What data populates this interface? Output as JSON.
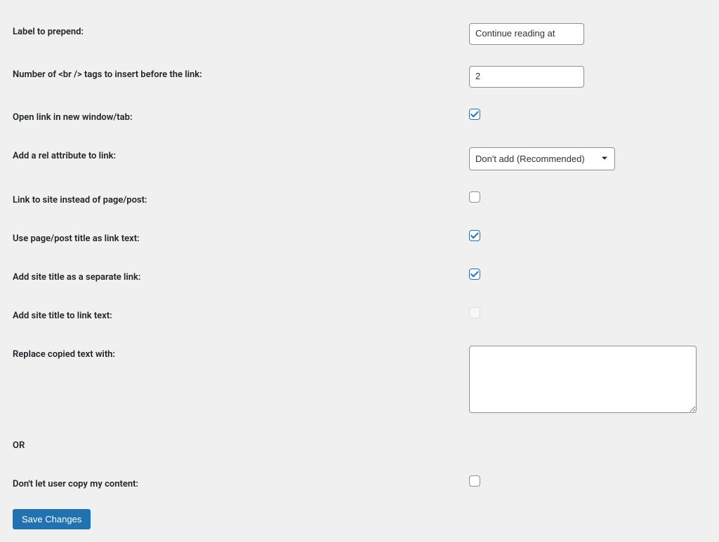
{
  "fields": {
    "label_prepend": {
      "label": "Label to prepend:",
      "value": "Continue reading at"
    },
    "br_count": {
      "label": "Number of <br /> tags to insert before the link:",
      "value": "2"
    },
    "open_new": {
      "label": "Open link in new window/tab:"
    },
    "rel_attr": {
      "label": "Add a rel attribute to link:",
      "selected": "Don't add (Recommended)"
    },
    "link_site": {
      "label": "Link to site instead of page/post:"
    },
    "title_as_link": {
      "label": "Use page/post title as link text:"
    },
    "site_title_sep": {
      "label": "Add site title as a separate link:"
    },
    "site_title_text": {
      "label": "Add site title to link text:"
    },
    "replace_text": {
      "label": "Replace copied text with:",
      "value": ""
    },
    "or": {
      "label": "OR"
    },
    "dont_copy": {
      "label": "Don't let user copy my content:"
    }
  },
  "buttons": {
    "save": "Save Changes"
  }
}
